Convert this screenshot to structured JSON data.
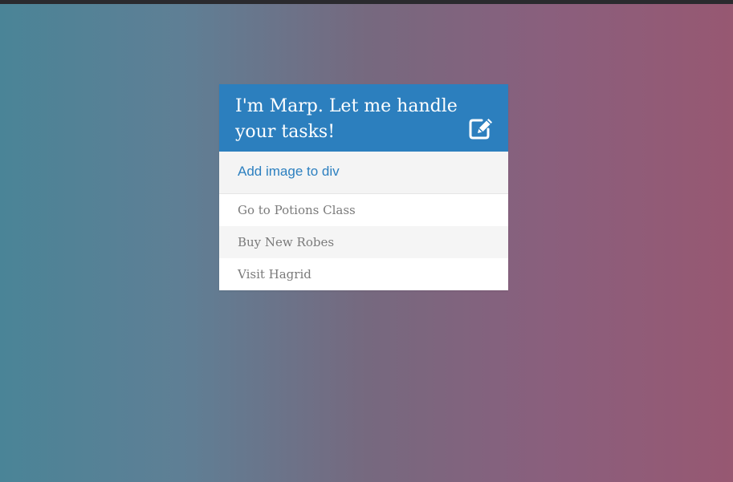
{
  "colors": {
    "header_bg": "#2c7fbe",
    "link": "#2d80c0",
    "task_text": "#7a7a7a",
    "background_left": "#4a8497",
    "background_right": "#975872"
  },
  "card": {
    "title": "I'm Marp. Let me handle your tasks!",
    "edit_icon": "edit-icon",
    "add_link": "Add image to div",
    "tasks": [
      "Go to Potions Class",
      "Buy New Robes",
      "Visit Hagrid"
    ]
  }
}
